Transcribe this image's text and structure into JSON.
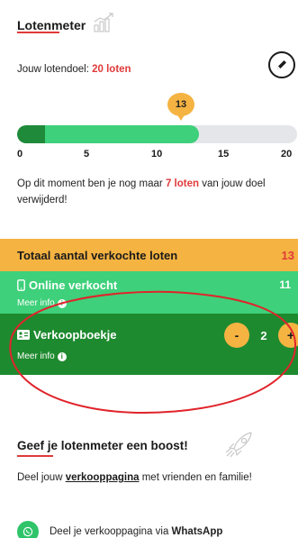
{
  "header": {
    "title": "Lotenmeter"
  },
  "goal": {
    "prefix": "Jouw lotendoel:",
    "value": "20 loten"
  },
  "progress": {
    "current_label": "13",
    "current": 13,
    "max": 20,
    "dark_segment": 2,
    "ticks": [
      "0",
      "5",
      "10",
      "15",
      "20"
    ]
  },
  "message": {
    "before": "Op dit moment ben je nog maar",
    "highlight": "7 loten",
    "after": "van jouw doel verwijderd!"
  },
  "totals": {
    "label": "Totaal aantal verkochte loten",
    "count": "13"
  },
  "online": {
    "label": "Online verkocht",
    "count": "11",
    "info": "Meer info"
  },
  "booklet": {
    "label": "Verkoopboekje",
    "info": "Meer info",
    "minus": "-",
    "plus": "+",
    "value": "2"
  },
  "boost": {
    "title": "Geef je lotenmeter een boost!",
    "text_before": "Deel jouw",
    "link": "verkooppagina",
    "text_after": "met vrienden en familie!"
  },
  "whatsapp": {
    "text": "Deel je verkooppagina via",
    "bold": "WhatsApp"
  },
  "colors": {
    "accent_red": "#e03a3a",
    "orange": "#f5b342",
    "light_green": "#3ed07a",
    "dark_green": "#1e8a2f"
  }
}
